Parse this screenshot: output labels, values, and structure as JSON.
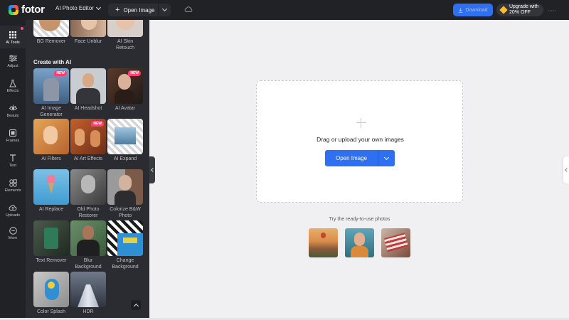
{
  "header": {
    "logo_text": "fotor",
    "editor_label": "AI Photo Editor",
    "open_image_label": "Open Image",
    "download_label": "Download",
    "upgrade_line1": "Upgrade with",
    "upgrade_line2": "20% OFF",
    "more_label": "·····"
  },
  "rail": {
    "items": [
      {
        "label": "AI Tools",
        "icon": "grid-icon"
      },
      {
        "label": "Adjust",
        "icon": "sliders-icon"
      },
      {
        "label": "Effects",
        "icon": "flask-icon"
      },
      {
        "label": "Beauty",
        "icon": "eye-icon"
      },
      {
        "label": "Frames",
        "icon": "frame-icon"
      },
      {
        "label": "Text",
        "icon": "text-icon"
      },
      {
        "label": "Elements",
        "icon": "shapes-icon"
      },
      {
        "label": "Uploads",
        "icon": "upload-icon"
      },
      {
        "label": "More",
        "icon": "more-icon"
      }
    ]
  },
  "panel": {
    "top_tools": [
      {
        "label": "BG Remover"
      },
      {
        "label": "Face Unblur"
      },
      {
        "label": "AI Skin Retouch"
      }
    ],
    "section_title": "Create with AI",
    "tools": [
      {
        "label": "AI Image Generator",
        "badge": "NEW"
      },
      {
        "label": "AI Headshot",
        "badge": ""
      },
      {
        "label": "AI Avatar",
        "badge": "NEW"
      },
      {
        "label": "AI Filters",
        "badge": ""
      },
      {
        "label": "AI Art Effects",
        "badge": "NEW"
      },
      {
        "label": "AI Expand",
        "badge": ""
      },
      {
        "label": "AI Replace",
        "badge": ""
      },
      {
        "label": "Old Photo Restorer",
        "badge": ""
      },
      {
        "label": "Colorize B&W Photo",
        "badge": ""
      },
      {
        "label": "Text Remover",
        "badge": ""
      },
      {
        "label": "Blur Background",
        "badge": ""
      },
      {
        "label": "Change Background",
        "badge": ""
      },
      {
        "label": "Color Splash",
        "badge": ""
      },
      {
        "label": "HDR",
        "badge": ""
      }
    ]
  },
  "canvas": {
    "drop_text": "Drag or upload your own images",
    "open_image_label": "Open Image",
    "ready_text": "Try the ready-to-use photos"
  },
  "colors": {
    "accent": "#2f6ff1",
    "badge": "#ff3f73",
    "dark_bg": "#212226"
  }
}
